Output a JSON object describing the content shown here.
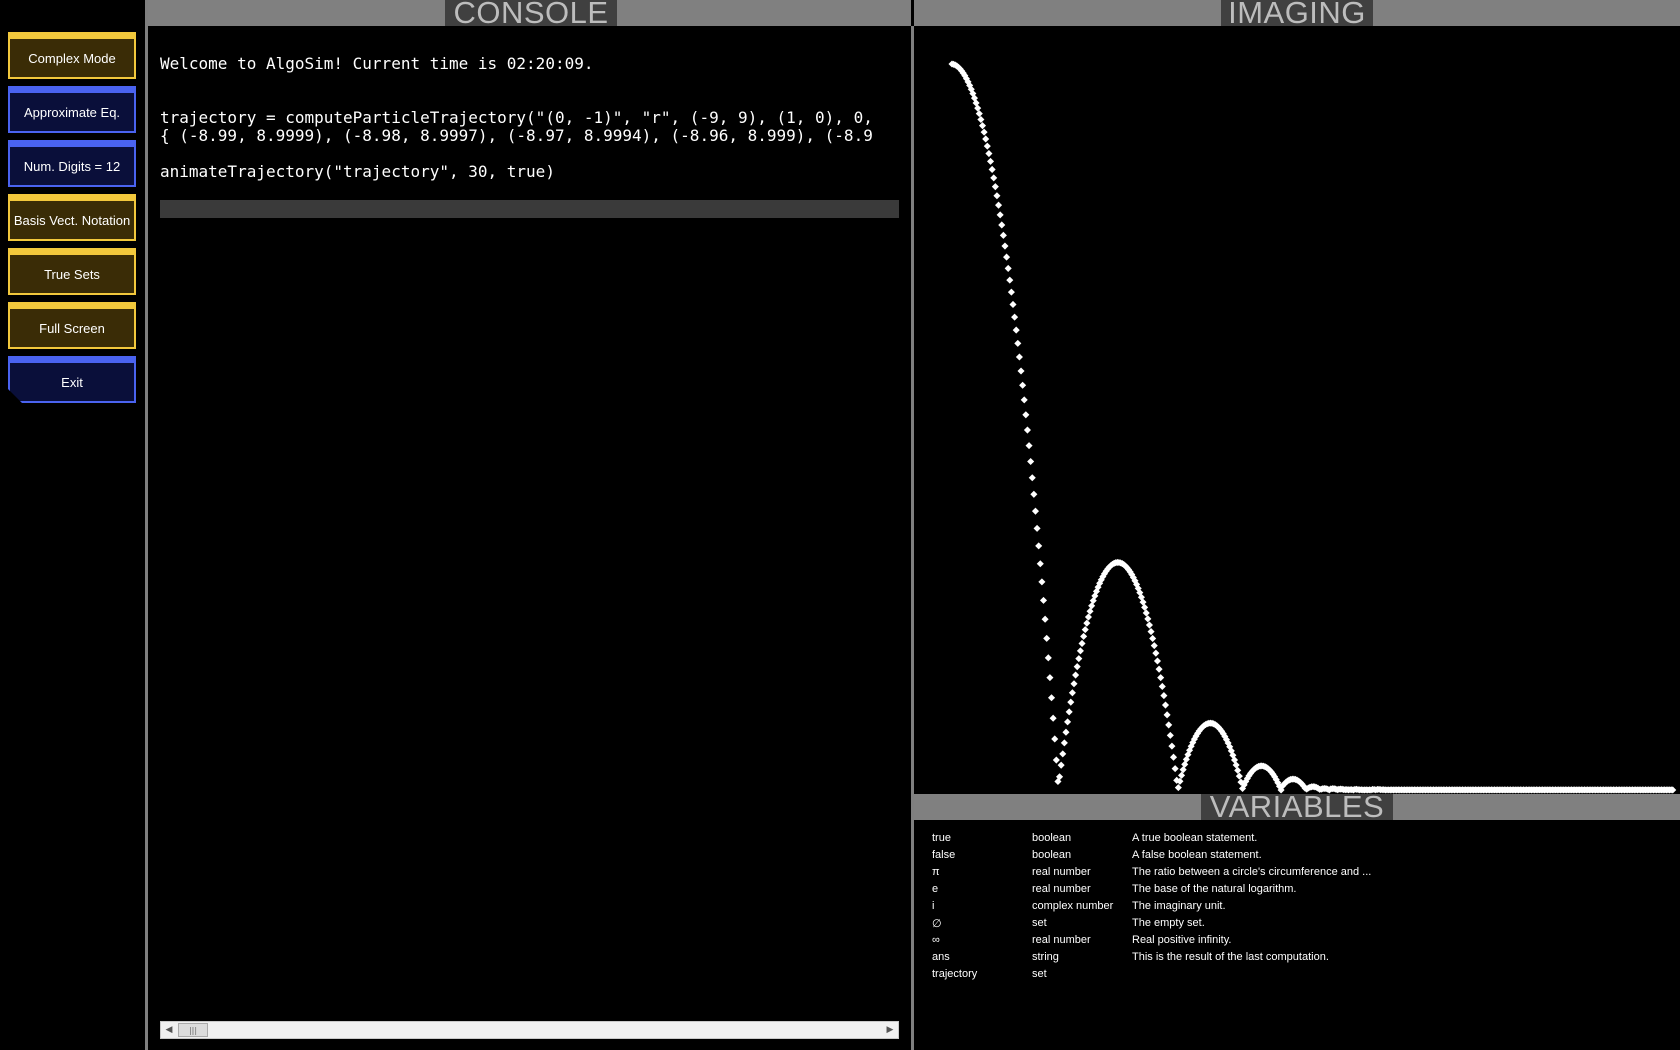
{
  "sidebar": {
    "buttons": [
      {
        "label": "Complex Mode",
        "style": "yellow"
      },
      {
        "label": "Approximate Eq.",
        "style": "blue"
      },
      {
        "label": "Num. Digits = 12",
        "style": "blue"
      },
      {
        "label": "Basis Vect. Notation",
        "style": "yellow"
      },
      {
        "label": "True Sets",
        "style": "yellow"
      },
      {
        "label": "Full Screen",
        "style": "yellow"
      },
      {
        "label": "Exit",
        "style": "blue"
      }
    ]
  },
  "console": {
    "title": "CONSOLE",
    "lines": [
      "Welcome to AlgoSim! Current time is 02:20:09.",
      "trajectory = computeParticleTrajectory(\"(0, -1)\", \"r\", (-9, 9), (1, 0), 0,",
      "{ (-8.99, 8.9999), (-8.98, 8.9997), (-8.97, 8.9994), (-8.96, 8.999), (-8.9",
      "animateTrajectory(\"trajectory\", 30, true)"
    ],
    "input_value": ""
  },
  "imaging": {
    "title": "IMAGING",
    "point_color": "#ffffff"
  },
  "variables": {
    "title": "VARIABLES",
    "rows": [
      {
        "name": "true",
        "type": "boolean",
        "desc": "A true boolean statement."
      },
      {
        "name": "false",
        "type": "boolean",
        "desc": "A false boolean statement."
      },
      {
        "name": "π",
        "type": "real number",
        "desc": "The ratio between a circle's circumference and ..."
      },
      {
        "name": "e",
        "type": "real number",
        "desc": "The base of the natural logarithm."
      },
      {
        "name": "i",
        "type": "complex number",
        "desc": "The imaginary unit."
      },
      {
        "name": "∅",
        "type": "set",
        "desc": "The empty set."
      },
      {
        "name": "∞",
        "type": "real number",
        "desc": "Real positive infinity."
      },
      {
        "name": "ans",
        "type": "string",
        "desc": "This is the result of the last computation."
      },
      {
        "name": "trajectory",
        "type": "set",
        "desc": ""
      }
    ]
  },
  "colors": {
    "yellow_button": "#f2c83c",
    "blue_button": "#4a63f0",
    "panel_header": "#808080",
    "header_tab": "#404040"
  }
}
